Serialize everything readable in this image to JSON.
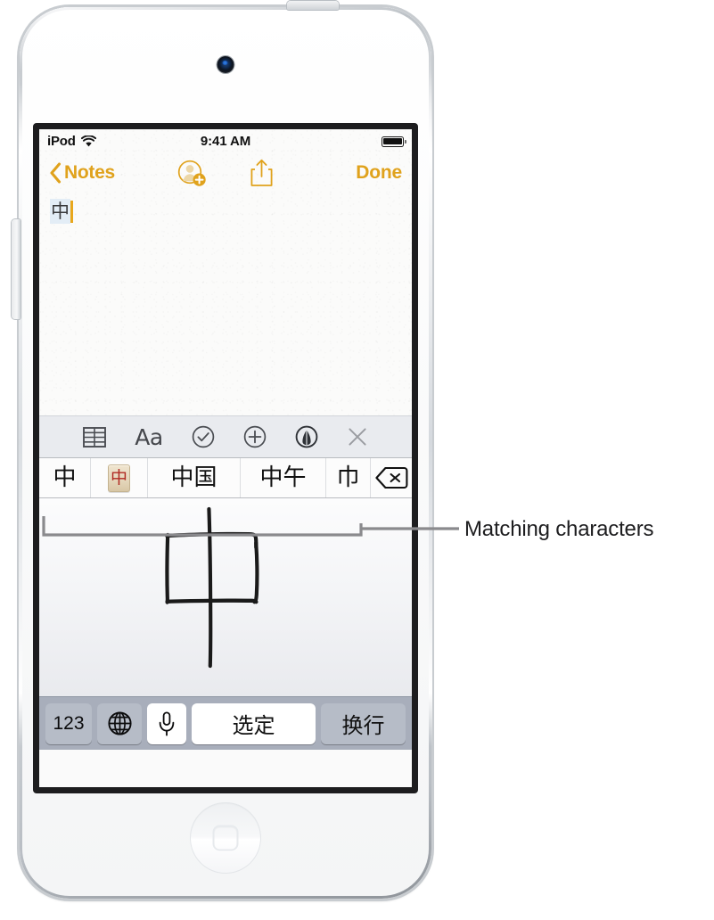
{
  "device": {
    "type": "ipod-touch",
    "camera": "front-camera",
    "home_button": "home-button",
    "buttons": [
      "power-button",
      "volume-button"
    ]
  },
  "status_bar": {
    "carrier": "iPod",
    "wifi_icon": "wifi-icon",
    "time": "9:41 AM",
    "battery_icon": "battery-full-icon"
  },
  "nav_bar": {
    "back_label": "Notes",
    "back_icon": "chevron-left-icon",
    "share_contact_icon": "add-person-icon",
    "share_icon": "share-icon",
    "done_label": "Done",
    "accent_color": "#e0a21c"
  },
  "note": {
    "text": "中",
    "caret_color": "#e8a71c",
    "highlight_color": "#e3edf6"
  },
  "note_toolbar": {
    "items": [
      {
        "name": "table-icon",
        "label": ""
      },
      {
        "name": "format-text-icon",
        "label": "Aa"
      },
      {
        "name": "checklist-icon",
        "label": ""
      },
      {
        "name": "add-attachment-icon",
        "label": ""
      },
      {
        "name": "markup-pen-icon",
        "label": ""
      },
      {
        "name": "close-icon",
        "label": ""
      }
    ],
    "background_color": "#e9ebef"
  },
  "candidates": {
    "items": [
      {
        "text": "中",
        "kind": "text"
      },
      {
        "text": "中",
        "kind": "emoji-tile"
      },
      {
        "text": "中国",
        "kind": "text"
      },
      {
        "text": "中午",
        "kind": "text"
      },
      {
        "text": "巾",
        "kind": "text"
      }
    ],
    "delete_icon": "backspace-delete-icon"
  },
  "handwriting": {
    "stroke_character": "中",
    "stroke_color": "#1a1a1a"
  },
  "keyboard": {
    "keys": [
      {
        "name": "numbers-key",
        "label": "123",
        "style": "gray"
      },
      {
        "name": "globe-key",
        "label": "",
        "icon": "globe-icon",
        "style": "gray"
      },
      {
        "name": "dictation-key",
        "label": "",
        "icon": "microphone-icon",
        "style": "white"
      },
      {
        "name": "select-key",
        "label": "选定",
        "style": "white"
      },
      {
        "name": "return-key",
        "label": "换行",
        "style": "gray"
      }
    ],
    "background_color": "#a8aebb"
  },
  "callout": {
    "label": "Matching characters",
    "line_color": "#8a8a8d"
  }
}
